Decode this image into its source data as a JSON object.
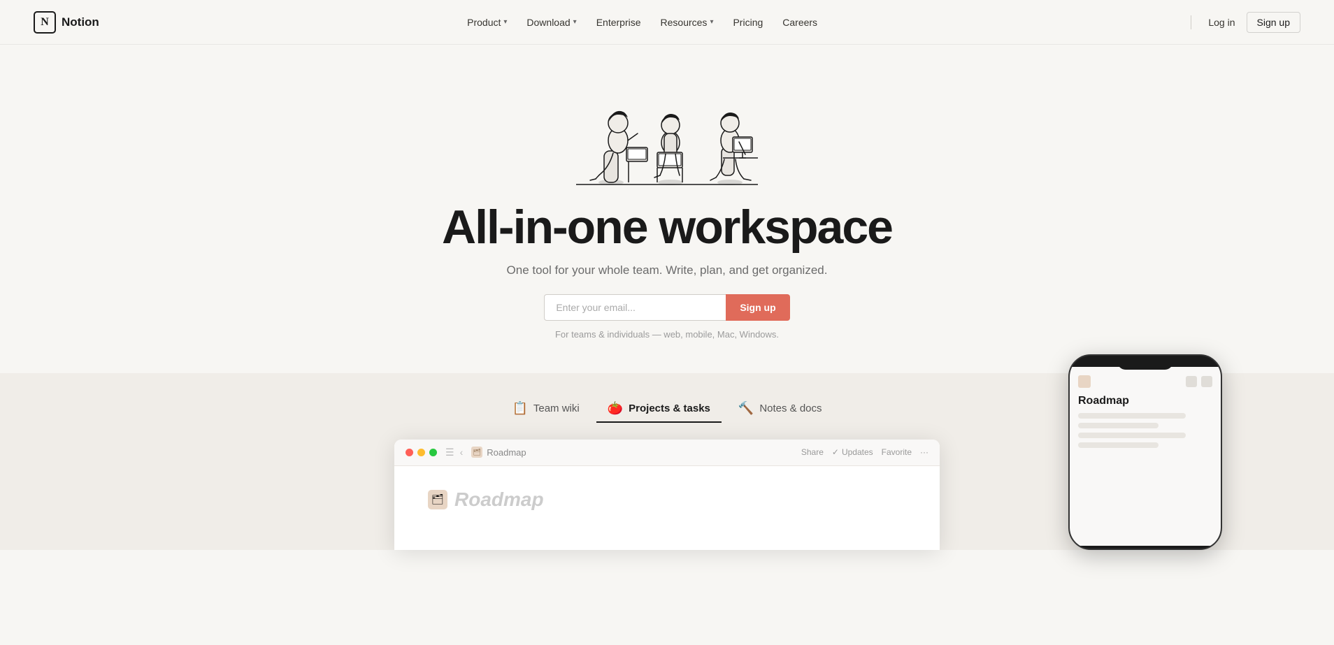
{
  "nav": {
    "logo_text": "Notion",
    "logo_letter": "N",
    "links": [
      {
        "label": "Product",
        "has_chevron": true,
        "id": "product"
      },
      {
        "label": "Download",
        "has_chevron": true,
        "id": "download"
      },
      {
        "label": "Enterprise",
        "has_chevron": false,
        "id": "enterprise"
      },
      {
        "label": "Resources",
        "has_chevron": true,
        "id": "resources"
      },
      {
        "label": "Pricing",
        "has_chevron": false,
        "id": "pricing"
      },
      {
        "label": "Careers",
        "has_chevron": false,
        "id": "careers"
      }
    ],
    "login_label": "Log in",
    "signup_label": "Sign up"
  },
  "hero": {
    "title": "All-in-one workspace",
    "subtitle": "One tool for your whole team. Write, plan, and get organized.",
    "email_placeholder": "Enter your email...",
    "cta_label": "Sign up",
    "note": "For teams & individuals — web, mobile, Mac, Windows."
  },
  "tabs": [
    {
      "label": "Team wiki",
      "emoji": "📋",
      "id": "team-wiki",
      "active": false
    },
    {
      "label": "Projects & tasks",
      "emoji": "🍅",
      "id": "projects-tasks",
      "active": true
    },
    {
      "label": "Notes & docs",
      "emoji": "🔨",
      "id": "notes-docs",
      "active": false
    }
  ],
  "demo_window": {
    "breadcrumb_page": "Roadmap",
    "action_share": "Share",
    "action_updates": "Updates",
    "action_updates_icon": "✓",
    "action_favorite": "Favorite",
    "page_title": "Roadmap"
  },
  "colors": {
    "accent": "#e06b5a",
    "background": "#f7f6f3",
    "section_bg": "#f0ede8"
  }
}
